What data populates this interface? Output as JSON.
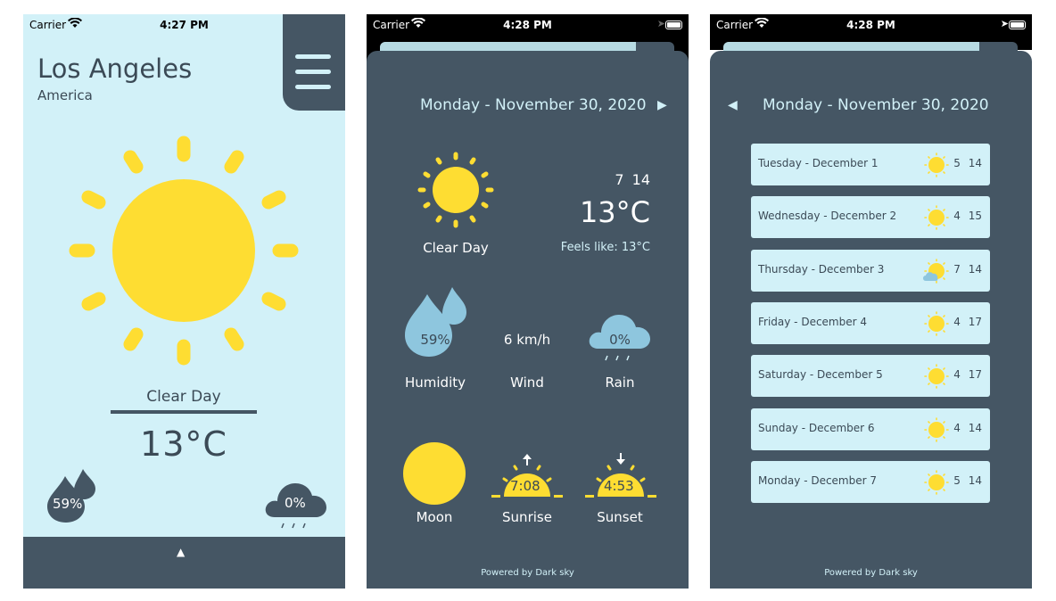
{
  "status": {
    "carrier": "Carrier",
    "time1": "4:27 PM",
    "time2": "4:28 PM",
    "time3": "4:28 PM"
  },
  "main": {
    "city": "Los Angeles",
    "country": "America",
    "condition": "Clear Day",
    "temperature": "13°C",
    "humidity": "59%",
    "rain": "0%"
  },
  "detail": {
    "date": "Monday - November 30, 2020",
    "low_high": "7 14",
    "temperature": "13°C",
    "condition": "Clear Day",
    "feels_like": "Feels like: 13°C",
    "humidity_value": "59%",
    "wind_value": "6 km/h",
    "rain_value": "0%",
    "labels": {
      "humidity": "Humidity",
      "wind": "Wind",
      "rain": "Rain",
      "moon": "Moon",
      "sunrise": "Sunrise",
      "sunset": "Sunset"
    },
    "sunrise_time": "7:08",
    "sunset_time": "4:53",
    "powered_by": "Powered by Dark sky"
  },
  "forecast": {
    "date": "Monday - November 30, 2020",
    "powered_by": "Powered by Dark sky",
    "days": [
      {
        "day": "Tuesday - December 1",
        "nums": "5 14",
        "icon": "sun-icon"
      },
      {
        "day": "Wednesday - December 2",
        "nums": "4 15",
        "icon": "sun-icon"
      },
      {
        "day": "Thursday - December 3",
        "nums": "7 14",
        "icon": "partly-cloudy-icon"
      },
      {
        "day": "Friday - December 4",
        "nums": "4 17",
        "icon": "sun-icon"
      },
      {
        "day": "Saturday - December 5",
        "nums": "4 17",
        "icon": "sun-icon"
      },
      {
        "day": "Sunday - December 6",
        "nums": "4 14",
        "icon": "sun-icon"
      },
      {
        "day": "Monday - December 7",
        "nums": "5 14",
        "icon": "sun-icon"
      }
    ]
  },
  "colors": {
    "panel": "#455664",
    "light": "#d2f1f8",
    "sun": "#fedd32",
    "drop": "#8ec6de"
  }
}
